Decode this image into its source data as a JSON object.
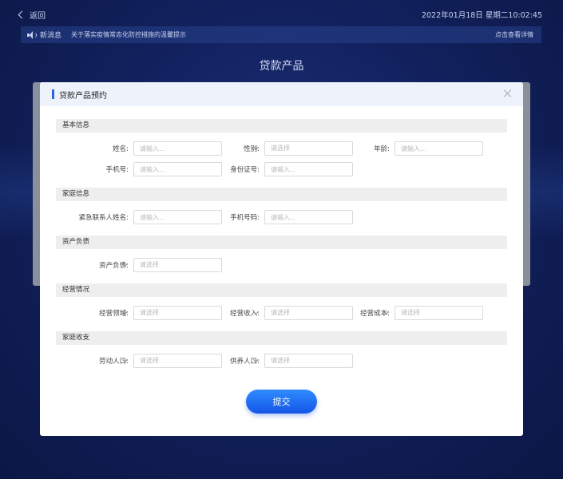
{
  "header": {
    "back_label": "返回",
    "datetime": "2022年01月18日 星期二10:02:45"
  },
  "notice": {
    "tag": "新消息",
    "message": "关于落实疫情常态化防控措施的温馨提示",
    "detail_link": "点击查看详情"
  },
  "page_title": "贷款产品",
  "modal": {
    "title": "贷款产品预约",
    "sections": {
      "basic": "基本信息",
      "family": "家庭信息",
      "assets": "资产负债",
      "business": "经营情况",
      "income": "家庭收支"
    },
    "fields": {
      "name": {
        "label": "姓名:",
        "placeholder": "请输入..."
      },
      "gender": {
        "label": "性别:",
        "value": "请选择"
      },
      "age": {
        "label": "年龄:",
        "placeholder": "请输入..."
      },
      "phone": {
        "label": "手机号:",
        "placeholder": "请输入..."
      },
      "id_number": {
        "label": "身份证号:",
        "placeholder": "请输入..."
      },
      "emergency_name": {
        "label": "紧急联系人姓名:",
        "placeholder": "请输入..."
      },
      "emergency_phone": {
        "label": "手机号码:",
        "placeholder": "请输入..."
      },
      "assets_liab": {
        "label": "资产负债:",
        "value": "请选择"
      },
      "biz_field": {
        "label": "经营领域:",
        "value": "请选择"
      },
      "biz_income": {
        "label": "经营收入:",
        "value": "请选择"
      },
      "biz_cost": {
        "label": "经营成本:",
        "value": "请选择"
      },
      "labor": {
        "label": "劳动人口:",
        "value": "请选择"
      },
      "dependents": {
        "label": "供养人口:",
        "value": "请选择"
      }
    },
    "submit_label": "提交"
  }
}
